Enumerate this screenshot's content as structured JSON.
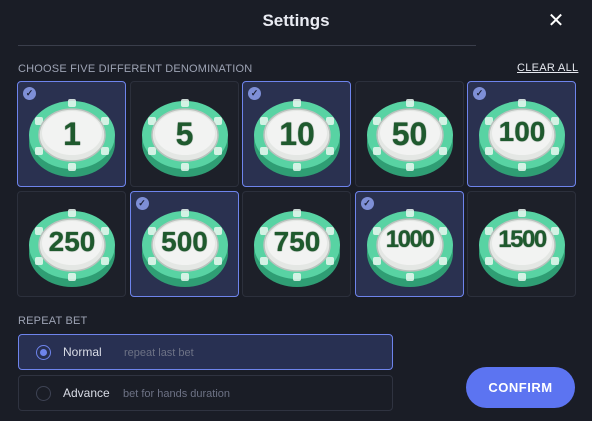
{
  "header": {
    "title": "Settings",
    "close_icon": "close-icon",
    "close_glyph": "✕"
  },
  "denominations": {
    "label": "CHOOSE FIVE DIFFERENT DENOMINATION",
    "clear_all": "CLEAR ALL",
    "check_glyph": "✓",
    "chips": [
      {
        "value": "1",
        "selected": true
      },
      {
        "value": "5",
        "selected": false
      },
      {
        "value": "10",
        "selected": true
      },
      {
        "value": "50",
        "selected": false
      },
      {
        "value": "100",
        "selected": true
      },
      {
        "value": "250",
        "selected": false
      },
      {
        "value": "500",
        "selected": true
      },
      {
        "value": "750",
        "selected": false
      },
      {
        "value": "1000",
        "selected": true
      },
      {
        "value": "1500",
        "selected": false
      }
    ]
  },
  "repeat_bet": {
    "label": "REPEAT BET",
    "options": [
      {
        "name": "Normal",
        "description": "repeat last bet",
        "selected": true
      },
      {
        "name": "Advance",
        "description": "bet for hands duration",
        "selected": false
      }
    ]
  },
  "confirm_label": "CONFIRM",
  "colors": {
    "accent": "#5c74f1",
    "selected_border": "#6e84ec",
    "chip_green": "#58d3a3",
    "chip_face": "#e4e7e4",
    "chip_text": "#1f5a2e",
    "background": "#1a1d26"
  }
}
